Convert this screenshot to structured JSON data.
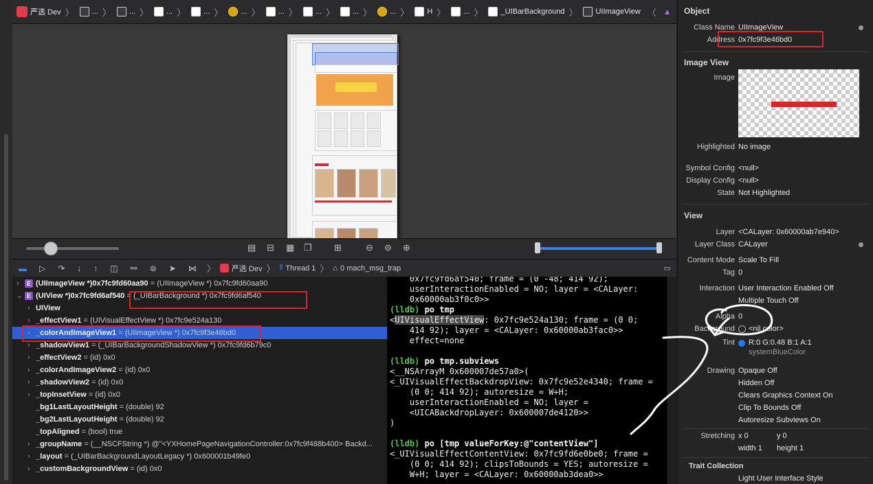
{
  "jumpbar": {
    "crumbs": [
      "严选 Dev",
      "...",
      "...",
      "...",
      "...",
      "...",
      "...",
      "...",
      "...",
      "...",
      "H",
      "...",
      "_UIBarBackground",
      "UIImageView"
    ]
  },
  "debugbar": {
    "app": "严选 Dev",
    "thread": "Thread 1",
    "frame": "0 mach_msg_trap"
  },
  "variables": [
    {
      "indent": 0,
      "chev": ">",
      "badge": "E",
      "name": "(UIImageView *)0x7fc9fd60aa90",
      "type": "= (UIImageView *) 0x7fc9fd60aa90"
    },
    {
      "indent": 0,
      "chev": "v",
      "badge": "E",
      "name": "(UIView *)0x7fc9fd6af540",
      "type": "= (_UIBarBackground *) 0x7fc9fd6af540"
    },
    {
      "indent": 1,
      "chev": ">",
      "badge": "",
      "name": "UIView",
      "type": ""
    },
    {
      "indent": 1,
      "chev": ">",
      "badge": "",
      "name": "_effectView1",
      "type": "= (UIVisualEffectView *) 0x7fc9e524a130"
    },
    {
      "indent": 1,
      "chev": ">",
      "badge": "",
      "name": "_colorAndImageView1",
      "type": "= (UIImageView *) 0x7fc9f3e46bd0"
    },
    {
      "indent": 1,
      "chev": ">",
      "badge": "",
      "name": "_shadowView1",
      "type": "= (_UIBarBackgroundShadowView *) 0x7fc9fd6b79c0"
    },
    {
      "indent": 1,
      "chev": ">",
      "badge": "",
      "name": "_effectView2",
      "type": "= (id) 0x0"
    },
    {
      "indent": 1,
      "chev": ">",
      "badge": "",
      "name": "_colorAndImageView2",
      "type": "= (id) 0x0"
    },
    {
      "indent": 1,
      "chev": ">",
      "badge": "",
      "name": "_shadowView2",
      "type": "= (id) 0x0"
    },
    {
      "indent": 1,
      "chev": ">",
      "badge": "",
      "name": "_topInsetView",
      "type": "= (id) 0x0"
    },
    {
      "indent": 1,
      "chev": "",
      "badge": "",
      "name": "_bg1LastLayoutHeight",
      "type": "= (double) 92"
    },
    {
      "indent": 1,
      "chev": "",
      "badge": "",
      "name": "_bg2LastLayoutHeight",
      "type": "= (double) 92"
    },
    {
      "indent": 1,
      "chev": "",
      "badge": "",
      "name": "_topAligned",
      "type": "= (bool) true"
    },
    {
      "indent": 1,
      "chev": ">",
      "badge": "",
      "name": "_groupName",
      "type": "= (__NSCFString *) @\"<YXHomePageNavigationController:0x7fc9f488b400> Backd..."
    },
    {
      "indent": 1,
      "chev": ">",
      "badge": "",
      "name": "_layout",
      "type": "= (_UIBarBackgroundLayoutLegacy *) 0x600001b49fe0"
    },
    {
      "indent": 1,
      "chev": ">",
      "badge": "",
      "name": "_customBackgroundView",
      "type": "= (id) 0x0"
    }
  ],
  "console": [
    "    0x7fc9fd6af540; frame = (0 -48; 414 92);",
    "    userInteractionEnabled = NO; layer = <CALayer:",
    "    0x60000ab3f0c0>>",
    "(lldb) po tmp",
    "<UIVisualEffectView: 0x7fc9e524a130; frame = (0 0;",
    "    414 92); layer = <CALayer: 0x60000ab3fac0>>",
    "    effect=none",
    "",
    "(lldb) po tmp.subviews",
    "<__NSArrayM 0x600007de57a0>(",
    "<_UIVisualEffectBackdropView: 0x7fc9e52e4340; frame =",
    "    (0 0; 414 92); autoresize = W+H;",
    "    userInteractionEnabled = NO; layer =",
    "    <UICABackdropLayer: 0x600007de4120>>",
    ")",
    "",
    "(lldb) po [tmp valueForKey:@\"contentView\"]",
    "<_UIVisualEffectContentView: 0x7fc9fd6e0be0; frame =",
    "    (0 0; 414 92); clipsToBounds = YES; autoresize =",
    "    W+H; layer = <CALayer: 0x60000ab3dea0>>"
  ],
  "inspector": {
    "object_header": "Object",
    "class_name_label": "Class Name",
    "class_name": "UIImageView",
    "address_label": "Address",
    "address": "0x7fc9f3e46bd0",
    "image_view_header": "Image View",
    "image_label": "Image",
    "highlighted_label": "Highlighted",
    "highlighted": "No image",
    "symbol_config_label": "Symbol Config",
    "symbol_config": "<null>",
    "display_config_label": "Display Config",
    "display_config": "<null>",
    "state_label": "State",
    "state": "Not Highlighted",
    "view_header": "View",
    "layer_label": "Layer",
    "layer": "<CALayer: 0x60000ab7e940>",
    "layer_class_label": "Layer Class",
    "layer_class": "CALayer",
    "content_mode_label": "Content Mode",
    "content_mode": "Scale To Fill",
    "tag_label": "Tag",
    "tag": "0",
    "interaction_label": "Interaction",
    "interaction1": "User Interaction Enabled Off",
    "interaction2": "Multiple Touch Off",
    "alpha_label": "Alpha",
    "alpha": "0",
    "background_label": "Background",
    "background": "<nil color>",
    "tint_label": "Tint",
    "tint": "R:0 G:0.48 B:1 A:1",
    "tint_name": "systemBlueColor",
    "drawing_label": "Drawing",
    "drawing": [
      "Opaque Off",
      "Hidden Off",
      "Clears Graphics Context On",
      "Clip To Bounds Off",
      "Autoresize Subviews On"
    ],
    "stretching_label": "Stretching",
    "stretch_x": "x 0",
    "stretch_y": "y 0",
    "stretch_w": "width 1",
    "stretch_h": "height 1",
    "trait_header": "Trait Collection",
    "trait_value": "Light User Interface Style"
  },
  "colors": {
    "selection": "#2f5fd0",
    "annotation": "#e0232b",
    "lldb_prompt": "#4ec94e",
    "tint_dot": "#1a7cff"
  }
}
